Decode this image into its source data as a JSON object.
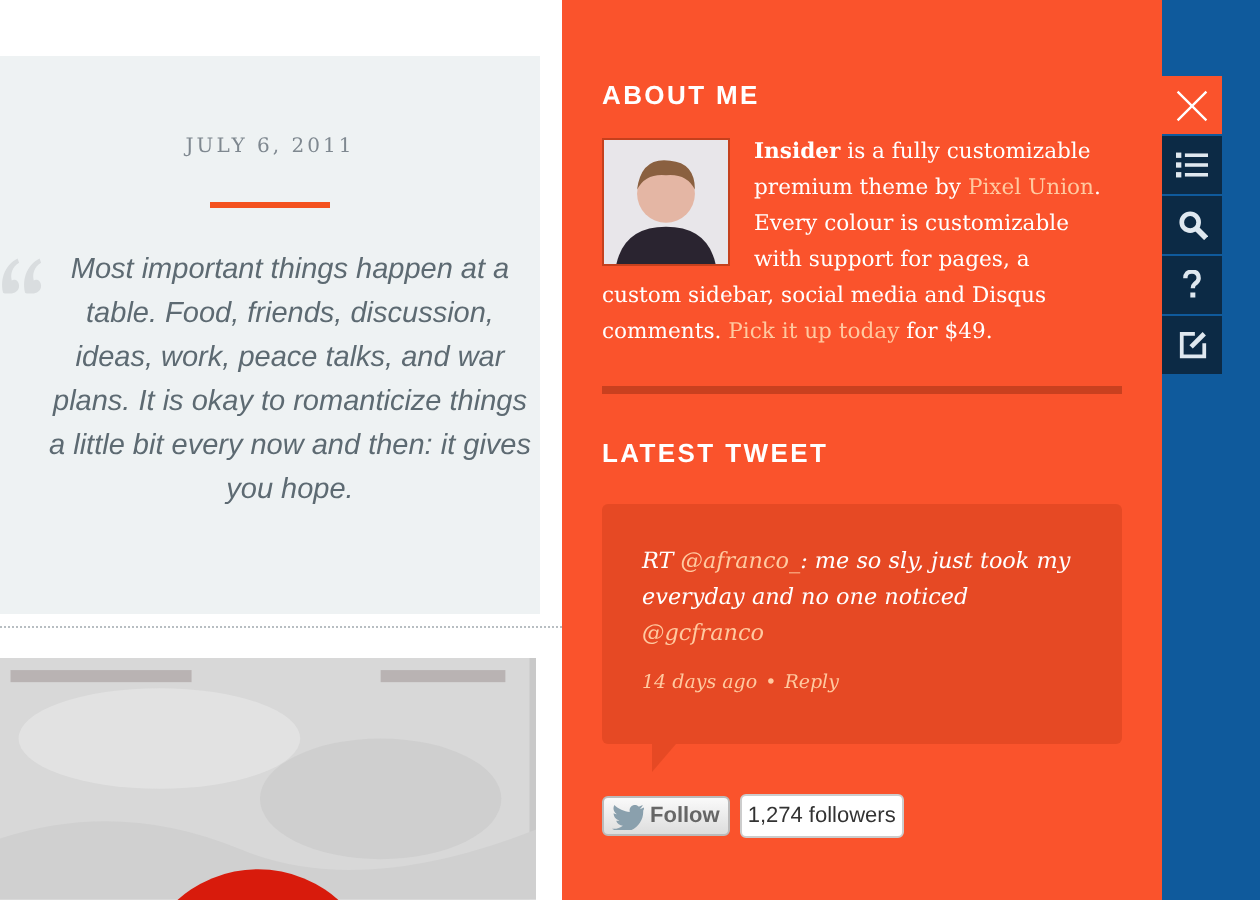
{
  "post": {
    "date": "JULY 6, 2011",
    "quote": "Most important things happen at a table. Food, friends, discussion, ideas, work, peace talks, and war plans. It is okay to romanticize things a little bit every now and then: it gives you hope."
  },
  "sidebar": {
    "about": {
      "heading": "ABOUT ME",
      "bio": [
        {
          "text": "**Insider** is a fully customizable premium theme by ",
          "link": false
        },
        {
          "text": "Pixel Union",
          "link": true
        },
        {
          "text": ". Every colour is customizable with support for pages, a",
          "link": false
        }
      ],
      "bio_continued": [
        {
          "text": "custom sidebar, social media and Disqus comments. ",
          "link": false
        },
        {
          "text": "Pick it up today",
          "link": true
        },
        {
          "text": " for $49.",
          "link": false
        }
      ]
    },
    "tweet": {
      "heading": "LATEST TWEET",
      "body": [
        {
          "text": "RT ",
          "link": false
        },
        {
          "text": "@afranco_",
          "link": true
        },
        {
          "text": ": me so sly, just took my everyday and no one noticed ",
          "link": false
        },
        {
          "text": "@gcfranco",
          "link": true
        }
      ],
      "time": "14 days ago",
      "separator": "•",
      "reply": "Reply"
    },
    "follow": {
      "button": "Follow",
      "count": "1,274 followers"
    }
  },
  "toolbar": [
    {
      "kind": "close",
      "selected": true
    },
    {
      "kind": "list",
      "selected": false
    },
    {
      "kind": "search",
      "selected": false
    },
    {
      "kind": "help",
      "selected": false
    },
    {
      "kind": "compose",
      "selected": false
    }
  ]
}
